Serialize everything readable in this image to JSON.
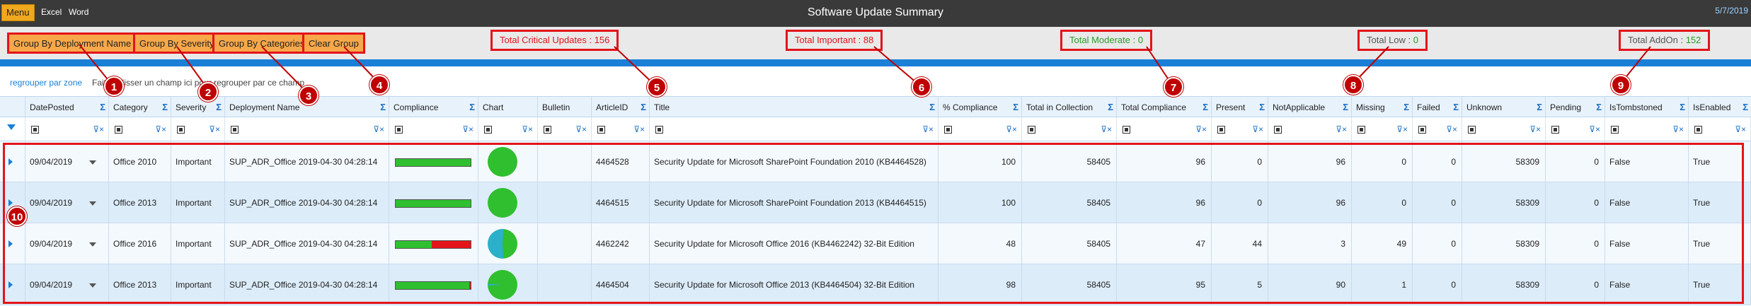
{
  "topbar": {
    "menu_label": "Menu",
    "nav_excel": "Excel",
    "nav_word": "Word",
    "title": "Software Update Summary",
    "date": "5/7/2019"
  },
  "group_buttons": {
    "by_deployment": "Group By Deployment Name",
    "by_severity": "Group By Severity",
    "by_categories": "Group By Categories",
    "clear": "Clear Group"
  },
  "totals": {
    "critical_label": "Total Critical Updates :",
    "critical_value": "156",
    "important_label": "Total Important :",
    "important_value": "88",
    "moderate_label": "Total Moderate :",
    "moderate_value": "0",
    "low_label": "Total Low :",
    "low_value": "0",
    "addon_label": "Total AddOn :",
    "addon_value": "152"
  },
  "group_zone": {
    "label": "regrouper par zone",
    "hint": "Faites glisser un champ ici pour regrouper par ce champ"
  },
  "callouts": [
    "1",
    "2",
    "3",
    "4",
    "5",
    "6",
    "7",
    "8",
    "9",
    "10"
  ],
  "columns": {
    "date_posted": "DatePosted",
    "category": "Category",
    "severity": "Severity",
    "deployment_name": "Deployment Name",
    "compliance": "Compliance",
    "chart": "Chart",
    "bulletin": "Bulletin",
    "articleid": "ArticleID",
    "title": "Title",
    "pct_compliance": "% Compliance",
    "total_in_collection": "Total in Collection",
    "total_compliance": "Total Compliance",
    "present": "Present",
    "not_applicable": "NotApplicable",
    "missing": "Missing",
    "failed": "Failed",
    "unknown": "Unknown",
    "pending": "Pending",
    "is_tombstoned": "IsTombstoned",
    "is_enabled": "IsEnabled"
  },
  "rows": [
    {
      "date": "09/04/2019",
      "category": "Office 2010",
      "severity": "Important",
      "deployment": "SUP_ADR_Office 2019-04-30 04:28:14",
      "compliance_pct": 100,
      "articleid": "4464528",
      "title": "Security Update for Microsoft SharePoint Foundation 2010 (KB4464528)",
      "pct": "100",
      "total_in_collection": "58405",
      "total_compliance": "96",
      "present": "0",
      "not_applicable": "96",
      "missing": "0",
      "failed": "0",
      "unknown": "58309",
      "pending": "0",
      "tombstoned": "False",
      "enabled": "True"
    },
    {
      "date": "09/04/2019",
      "category": "Office 2013",
      "severity": "Important",
      "deployment": "SUP_ADR_Office 2019-04-30 04:28:14",
      "compliance_pct": 100,
      "articleid": "4464515",
      "title": "Security Update for Microsoft SharePoint Foundation 2013 (KB4464515)",
      "pct": "100",
      "total_in_collection": "58405",
      "total_compliance": "96",
      "present": "0",
      "not_applicable": "96",
      "missing": "0",
      "failed": "0",
      "unknown": "58309",
      "pending": "0",
      "tombstoned": "False",
      "enabled": "True"
    },
    {
      "date": "09/04/2019",
      "category": "Office 2016",
      "severity": "Important",
      "deployment": "SUP_ADR_Office 2019-04-30 04:28:14",
      "compliance_pct": 48,
      "articleid": "4462242",
      "title": "Security Update for Microsoft Office 2016 (KB4462242) 32-Bit Edition",
      "pct": "48",
      "total_in_collection": "58405",
      "total_compliance": "47",
      "present": "44",
      "not_applicable": "3",
      "missing": "49",
      "failed": "0",
      "unknown": "58309",
      "pending": "0",
      "tombstoned": "False",
      "enabled": "True"
    },
    {
      "date": "09/04/2019",
      "category": "Office 2013",
      "severity": "Important",
      "deployment": "SUP_ADR_Office 2019-04-30 04:28:14",
      "compliance_pct": 98,
      "articleid": "4464504",
      "title": "Security Update for Microsoft Office 2013 (KB4464504) 32-Bit Edition",
      "pct": "98",
      "total_in_collection": "58405",
      "total_compliance": "95",
      "present": "5",
      "not_applicable": "90",
      "missing": "1",
      "failed": "0",
      "unknown": "58309",
      "pending": "0",
      "tombstoned": "False",
      "enabled": "True"
    }
  ],
  "colors": {
    "accent": "#1a7fd6",
    "callout": "#c00000",
    "highlight_border": "#e3141a",
    "compliant": "#2fbf2f",
    "non_compliant": "#e3141a",
    "pie_missing": "#2ab0c8"
  }
}
